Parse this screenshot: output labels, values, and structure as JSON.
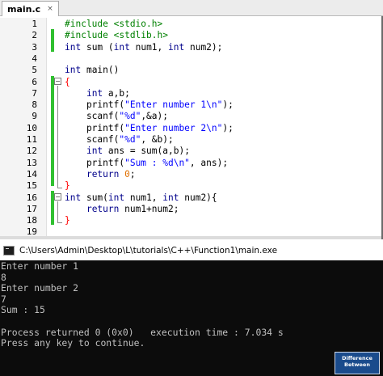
{
  "editor": {
    "tab_label": "main.c",
    "tab_close": "×",
    "lines": [
      {
        "n": "1",
        "segments": [
          {
            "t": "#include <stdio.h>",
            "c": "pp"
          }
        ]
      },
      {
        "n": "2",
        "segments": [
          {
            "t": "#include <stdlib.h>",
            "c": "pp"
          }
        ]
      },
      {
        "n": "3",
        "segments": [
          {
            "t": "int",
            "c": "kw"
          },
          {
            "t": " sum (",
            "c": ""
          },
          {
            "t": "int",
            "c": "kw"
          },
          {
            "t": " num1, ",
            "c": ""
          },
          {
            "t": "int",
            "c": "kw"
          },
          {
            "t": " num2);",
            "c": ""
          }
        ]
      },
      {
        "n": "4",
        "segments": []
      },
      {
        "n": "5",
        "segments": [
          {
            "t": "int",
            "c": "kw"
          },
          {
            "t": " main()",
            "c": ""
          }
        ]
      },
      {
        "n": "6",
        "segments": [
          {
            "t": "{",
            "c": "brace-red"
          }
        ]
      },
      {
        "n": "7",
        "segments": [
          {
            "t": "    ",
            "c": ""
          },
          {
            "t": "int",
            "c": "kw"
          },
          {
            "t": " a,b;",
            "c": ""
          }
        ]
      },
      {
        "n": "8",
        "segments": [
          {
            "t": "    printf(",
            "c": ""
          },
          {
            "t": "\"Enter number 1\\n\"",
            "c": "str"
          },
          {
            "t": ");",
            "c": ""
          }
        ]
      },
      {
        "n": "9",
        "segments": [
          {
            "t": "    scanf(",
            "c": ""
          },
          {
            "t": "\"%d\"",
            "c": "str"
          },
          {
            "t": ",&a);",
            "c": ""
          }
        ]
      },
      {
        "n": "10",
        "segments": [
          {
            "t": "    printf(",
            "c": ""
          },
          {
            "t": "\"Enter number 2\\n\"",
            "c": "str"
          },
          {
            "t": ");",
            "c": ""
          }
        ]
      },
      {
        "n": "11",
        "segments": [
          {
            "t": "    scanf(",
            "c": ""
          },
          {
            "t": "\"%d\"",
            "c": "str"
          },
          {
            "t": ", &b);",
            "c": ""
          }
        ]
      },
      {
        "n": "12",
        "segments": [
          {
            "t": "    ",
            "c": ""
          },
          {
            "t": "int",
            "c": "kw"
          },
          {
            "t": " ans = sum(a,b);",
            "c": ""
          }
        ]
      },
      {
        "n": "13",
        "segments": [
          {
            "t": "    printf(",
            "c": ""
          },
          {
            "t": "\"Sum : %d\\n\"",
            "c": "str"
          },
          {
            "t": ", ans);",
            "c": ""
          }
        ]
      },
      {
        "n": "14",
        "segments": [
          {
            "t": "    ",
            "c": ""
          },
          {
            "t": "return",
            "c": "kw"
          },
          {
            "t": " ",
            "c": ""
          },
          {
            "t": "0",
            "c": "num"
          },
          {
            "t": ";",
            "c": ""
          }
        ]
      },
      {
        "n": "15",
        "segments": [
          {
            "t": "}",
            "c": "brace-red"
          }
        ]
      },
      {
        "n": "16",
        "segments": [
          {
            "t": "int",
            "c": "kw"
          },
          {
            "t": " sum(",
            "c": ""
          },
          {
            "t": "int",
            "c": "kw"
          },
          {
            "t": " num1, ",
            "c": ""
          },
          {
            "t": "int",
            "c": "kw"
          },
          {
            "t": " num2){",
            "c": ""
          }
        ]
      },
      {
        "n": "17",
        "segments": [
          {
            "t": "    ",
            "c": ""
          },
          {
            "t": "return",
            "c": "kw"
          },
          {
            "t": " num1+num2;",
            "c": ""
          }
        ]
      },
      {
        "n": "18",
        "segments": [
          {
            "t": "}",
            "c": "brace-red"
          }
        ]
      },
      {
        "n": "19",
        "segments": []
      }
    ]
  },
  "console": {
    "title": "C:\\Users\\Admin\\Desktop\\L\\tutorials\\C++\\Function1\\main.exe",
    "lines": [
      "Enter number 1",
      "8",
      "Enter number 2",
      "7",
      "Sum : 15",
      "",
      "Process returned 0 (0x0)   execution time : 7.034 s",
      "Press any key to continue."
    ]
  },
  "watermark": {
    "line1": "Difference",
    "line2": "Between"
  },
  "colors": {
    "keyword": "#00008b",
    "string": "#0000ff",
    "preprocessor": "#008000",
    "number": "#e07000",
    "brace": "#ff0000",
    "change_bar": "#30c030",
    "console_bg": "#0c0c0c",
    "console_text": "#c0c0c0"
  }
}
